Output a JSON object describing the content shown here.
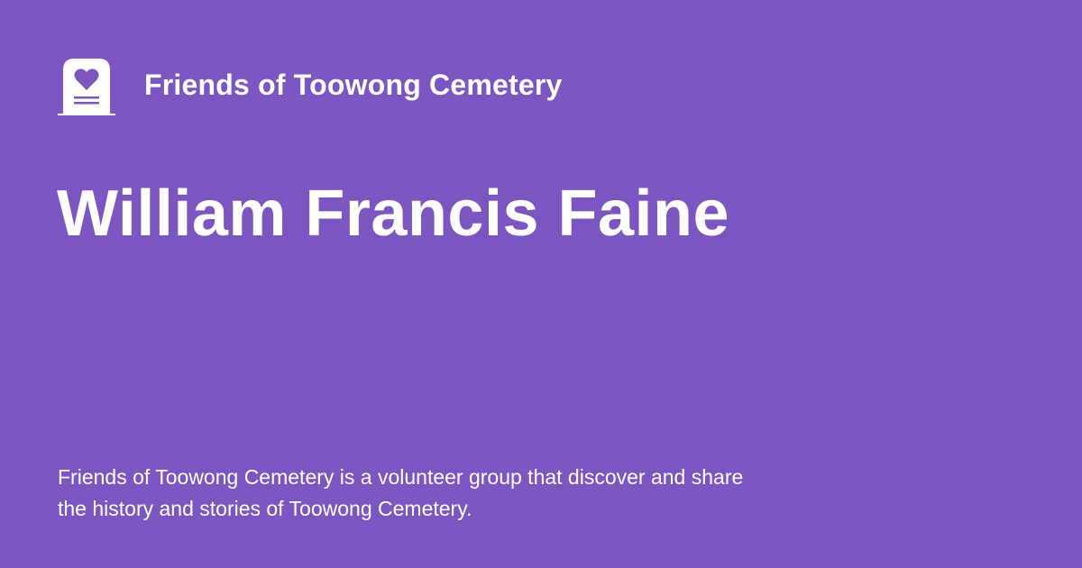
{
  "site_name": "Friends of Toowong Cemetery",
  "page_title": "William Francis Faine",
  "description": "Friends of Toowong Cemetery is a volunteer group that discover and share the history and stories of Toowong Cemetery.",
  "colors": {
    "background": "#7b56c0",
    "text": "#ffffff"
  },
  "logo_icon": "tombstone-heart-icon"
}
